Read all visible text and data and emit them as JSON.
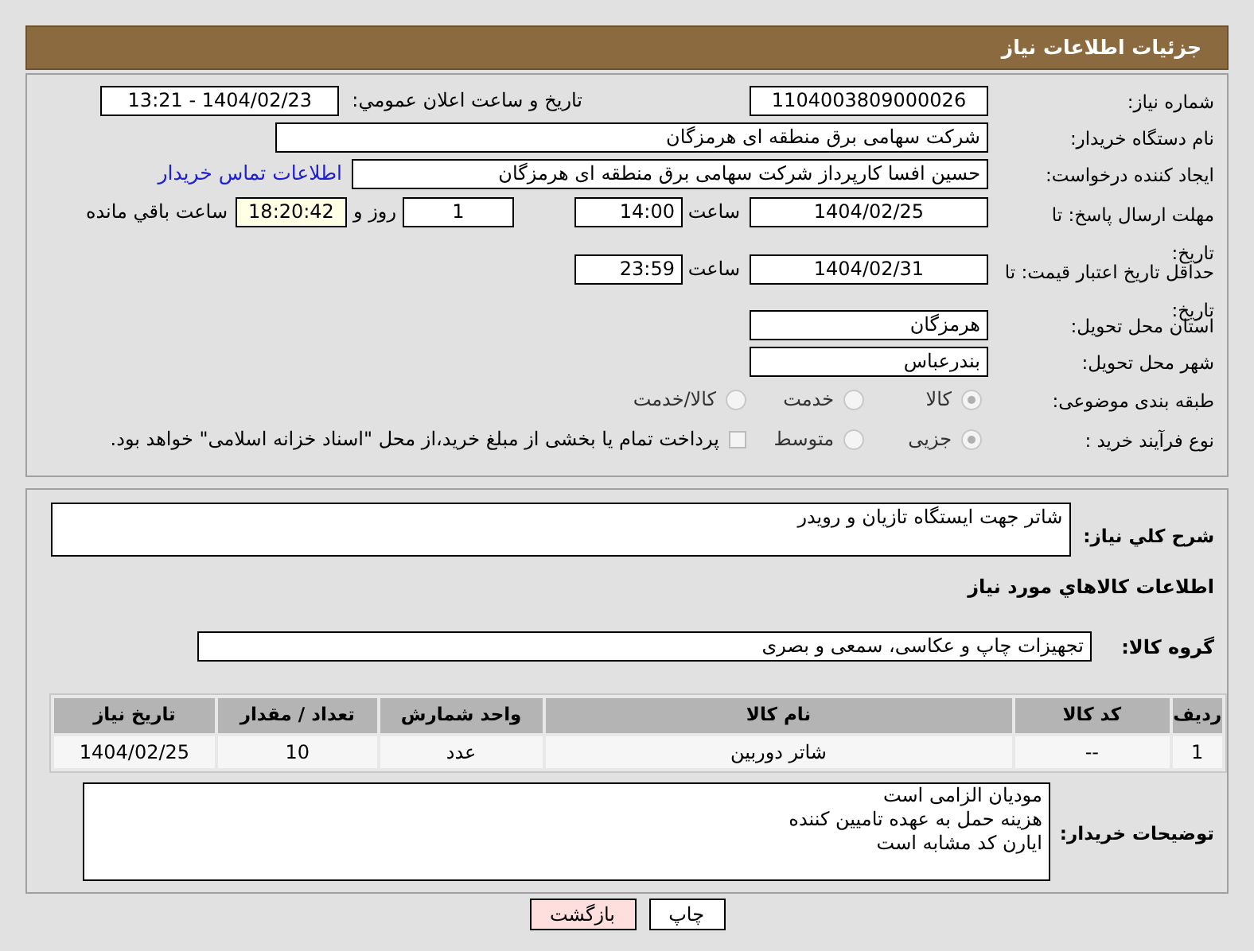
{
  "header": {
    "title": "جزئیات اطلاعات نیاز"
  },
  "details": {
    "need_number": {
      "label": "شماره نیاز:",
      "value": "1104003809000026"
    },
    "announce": {
      "label": "تاریخ و ساعت اعلان عمومي:",
      "value": "1404/02/23 - 13:21"
    },
    "buyer": {
      "label": "نام دستگاه خریدار:",
      "value": "شرکت سهامی برق منطقه ای هرمزگان"
    },
    "creator": {
      "label": "ایجاد کننده درخواست:",
      "value": "حسین افسا کارپرداز شرکت سهامی برق منطقه ای هرمزگان",
      "link": "اطلاعات تماس خریدار"
    },
    "deadline": {
      "label": "مهلت ارسال پاسخ: تا تاریخ:",
      "date": "1404/02/25",
      "time_label": "ساعت",
      "time": "14:00",
      "days": "1",
      "days_label": "روز و",
      "remaining": "18:20:42",
      "remaining_label": "ساعت باقي مانده"
    },
    "validity": {
      "label": "حداقل تاریخ اعتبار قیمت: تا تاریخ:",
      "date": "1404/02/31",
      "time_label": "ساعت",
      "time": "23:59"
    },
    "province": {
      "label": "استان محل تحویل:",
      "value": "هرمزگان"
    },
    "city": {
      "label": "شهر محل تحویل:",
      "value": "بندرعباس"
    },
    "category": {
      "label": "طبقه بندی موضوعی:",
      "options": [
        {
          "label": "کالا",
          "selected": true
        },
        {
          "label": "خدمت",
          "selected": false
        },
        {
          "label": "کالا/خدمت",
          "selected": false
        }
      ]
    },
    "process": {
      "label": "نوع فرآیند خرید :",
      "options": [
        {
          "label": "جزیی",
          "selected": true
        },
        {
          "label": "متوسط",
          "selected": false
        }
      ],
      "treasury": {
        "label": "پرداخت تمام یا بخشی از مبلغ خرید،از محل \"اسناد خزانه اسلامی\" خواهد بود.",
        "checked": false
      }
    }
  },
  "goods": {
    "description": {
      "label": "شرح کلي نیاز:",
      "value": "شاتر جهت ایستگاه تازیان و رویدر"
    },
    "section_title": "اطلاعات کالاهاي مورد نیاز",
    "group": {
      "label": "گروه کالا:",
      "value": "تجهیزات چاپ و عکاسی، سمعی و بصری"
    },
    "table": {
      "columns": [
        "ردیف",
        "کد کالا",
        "نام کالا",
        "واحد شمارش",
        "تعداد / مقدار",
        "تاریخ نیاز"
      ],
      "rows": [
        [
          "1",
          "--",
          "شاتر دوربین",
          "عدد",
          "10",
          "1404/02/25"
        ]
      ]
    },
    "notes": {
      "label": "توضیحات خریدار:",
      "lines": [
        "مودیان الزامی است",
        "هزینه حمل به عهده تامیین کننده",
        "ایارن کد مشابه است"
      ]
    }
  },
  "buttons": [
    {
      "label": "چاپ",
      "kind": "print"
    },
    {
      "label": "بازگشت",
      "kind": "back"
    }
  ]
}
